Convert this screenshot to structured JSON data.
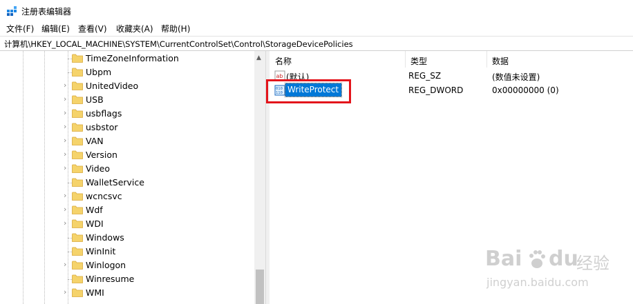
{
  "window": {
    "title": "注册表编辑器"
  },
  "menu": {
    "items": [
      {
        "label": "文件(F)"
      },
      {
        "label": "编辑(E)"
      },
      {
        "label": "查看(V)"
      },
      {
        "label": "收藏夹(A)"
      },
      {
        "label": "帮助(H)"
      }
    ]
  },
  "address": {
    "path": "计算机\\HKEY_LOCAL_MACHINE\\SYSTEM\\CurrentControlSet\\Control\\StorageDevicePolicies"
  },
  "tree": {
    "items": [
      {
        "label": "TimeZoneInformation",
        "expandable": false
      },
      {
        "label": "Ubpm",
        "expandable": false
      },
      {
        "label": "UnitedVideo",
        "expandable": true
      },
      {
        "label": "USB",
        "expandable": true
      },
      {
        "label": "usbflags",
        "expandable": true
      },
      {
        "label": "usbstor",
        "expandable": true
      },
      {
        "label": "VAN",
        "expandable": true
      },
      {
        "label": "Version",
        "expandable": true
      },
      {
        "label": "Video",
        "expandable": true
      },
      {
        "label": "WalletService",
        "expandable": false
      },
      {
        "label": "wcncsvc",
        "expandable": true
      },
      {
        "label": "Wdf",
        "expandable": true
      },
      {
        "label": "WDI",
        "expandable": true
      },
      {
        "label": "Windows",
        "expandable": false
      },
      {
        "label": "WinInit",
        "expandable": false
      },
      {
        "label": "Winlogon",
        "expandable": true
      },
      {
        "label": "Winresume",
        "expandable": false
      },
      {
        "label": "WMI",
        "expandable": true
      }
    ]
  },
  "list": {
    "columns": {
      "name": "名称",
      "type": "类型",
      "data": "数据"
    },
    "rows": [
      {
        "icon": "string-value-icon",
        "name": "(默认)",
        "type": "REG_SZ",
        "data": "(数值未设置)",
        "selected": false
      },
      {
        "icon": "dword-value-icon",
        "name": "WriteProtect",
        "type": "REG_DWORD",
        "data": "0x00000000 (0)",
        "selected": true
      }
    ]
  },
  "watermark": {
    "brand": "Bai",
    "brand2": "du",
    "cn": "经验",
    "url": "jingyan.baidu.com"
  },
  "colors": {
    "selection": "#0078d7",
    "highlight_box": "#e3141b",
    "folder": "#f5d36b"
  }
}
